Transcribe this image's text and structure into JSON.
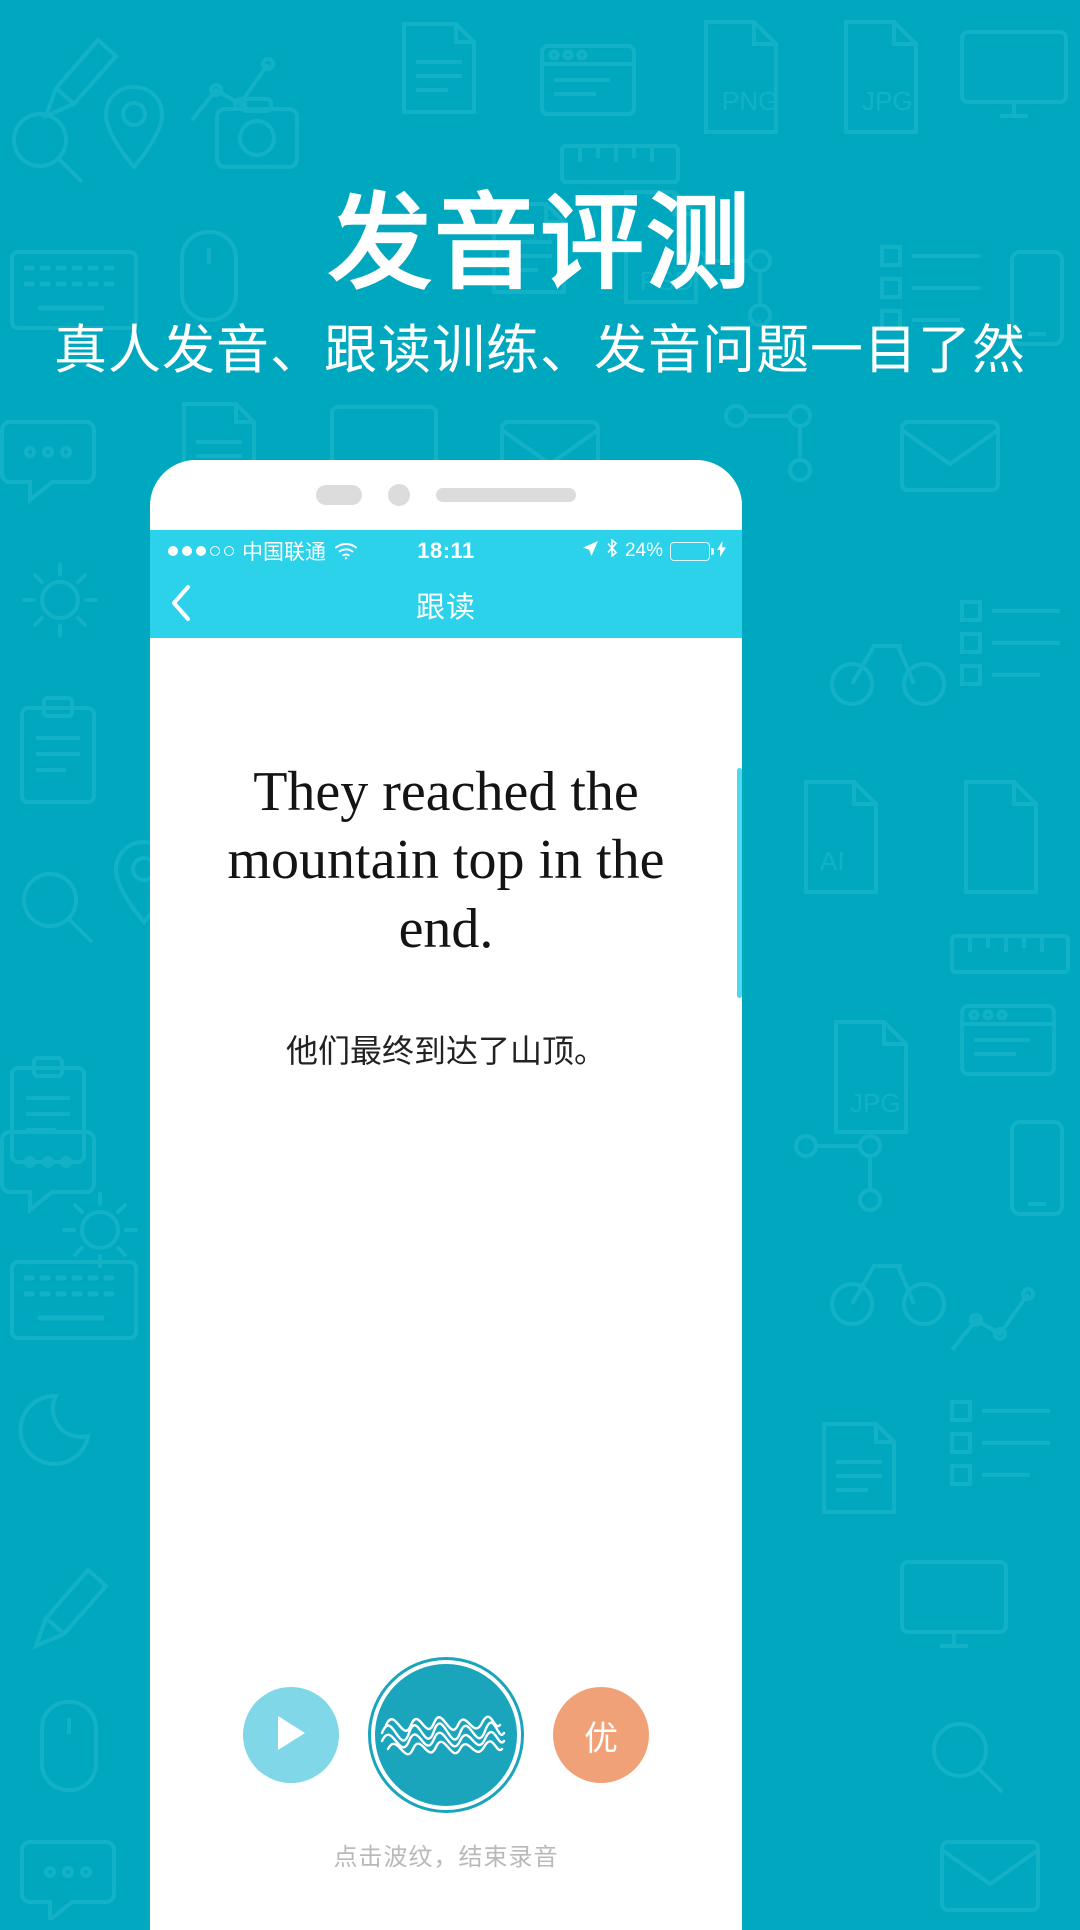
{
  "banner": {
    "title": "发音评测",
    "subtitle": "真人发音、跟读训练、发音问题一目了然",
    "background_color": "#00a8bf",
    "text_color": "#ffffff"
  },
  "phone": {
    "status_bar": {
      "signal_dots_filled": 3,
      "signal_dots_total": 5,
      "carrier": "中国联通",
      "wifi_icon": "wifi-icon",
      "time": "18:11",
      "location_icon": "location-arrow-icon",
      "bluetooth_icon": "bluetooth-icon",
      "battery_percent": "24%",
      "battery_level": 24,
      "charging_icon": "lightning-bolt-icon",
      "background_color": "#2bd2ea"
    },
    "nav_bar": {
      "back_icon": "chevron-left-icon",
      "title": "跟读",
      "background_color": "#2bd2ea"
    },
    "content": {
      "sentence_en": "They reached the mountain top in the end.",
      "sentence_cn": "他们最终到达了山顶。"
    },
    "controls": {
      "play_icon": "play-triangle-icon",
      "play_color": "#7fd7e8",
      "record_icon": "waveform-icon",
      "record_color": "#1aa5bd",
      "score_label": "优",
      "score_color": "#f0a177",
      "hint": "点击波纹，结束录音"
    }
  }
}
